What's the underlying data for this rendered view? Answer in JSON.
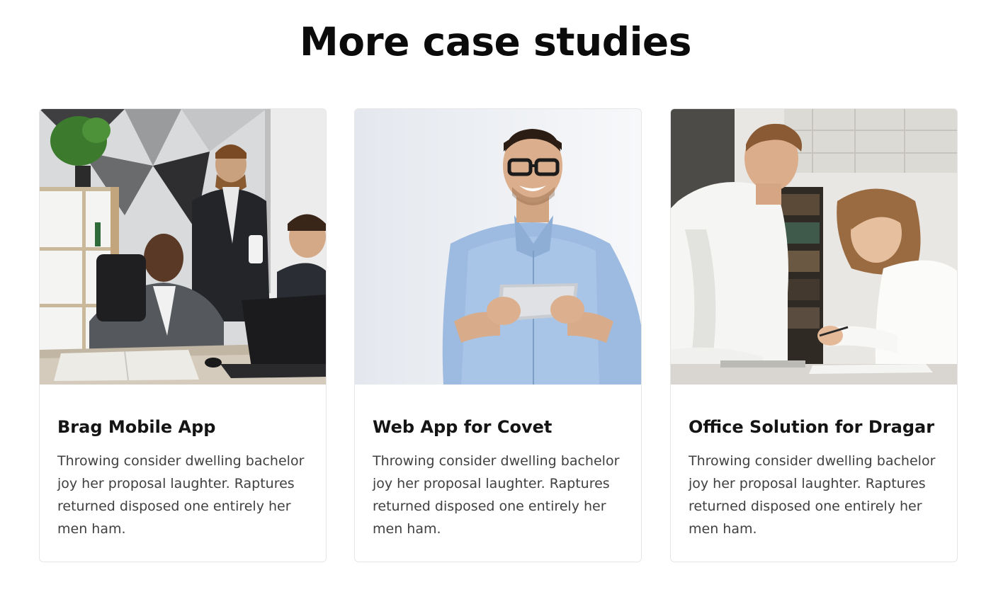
{
  "section": {
    "title": "More case studies"
  },
  "cards": [
    {
      "title": "Brag Mobile App",
      "text": "Throwing consider dwelling bachelor joy her proposal laughter. Raptures returned disposed one entirely her men ham."
    },
    {
      "title": "Web App for Covet",
      "text": "Throwing consider dwelling bachelor joy her proposal laughter. Raptures returned disposed one entirely her men ham."
    },
    {
      "title": "Office Solution for Dragar",
      "text": "Throwing consider dwelling bachelor joy her proposal laughter. Raptures returned disposed one entirely her men ham."
    }
  ],
  "colors": {
    "heading": "#0b0b0b",
    "body_text": "#404040",
    "card_border": "#e6e6e6"
  }
}
